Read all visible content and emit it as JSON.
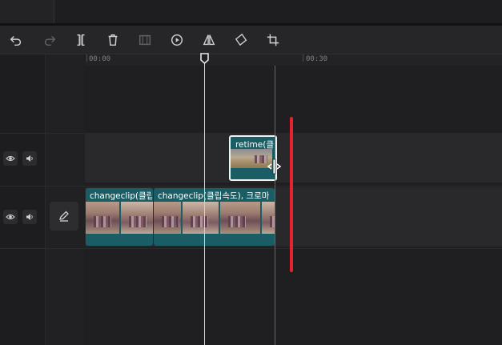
{
  "toolbar": {
    "undo_icon": "undo-icon",
    "redo_icon": "redo-icon",
    "split_icon": "split-icon",
    "delete_icon": "trash-icon",
    "freeze_icon": "freeze-frame-icon",
    "play_icon": "play-circle-icon",
    "mirror_icon": "mirror-icon",
    "rotate_icon": "rotate-icon",
    "crop_icon": "crop-icon"
  },
  "ruler": {
    "labels": [
      "00:00",
      "00:30"
    ]
  },
  "tracks": [
    {
      "eye_icon": "eye-icon",
      "volume_icon": "volume-icon",
      "clips": [
        {
          "name": "retime(클"
        }
      ]
    },
    {
      "eye_icon": "eye-icon",
      "volume_icon": "volume-icon",
      "edit_icon": "pencil-icon",
      "clips": [
        {
          "name": "changeclip(클립"
        },
        {
          "name": "changeclip(클립속도), 크로마"
        }
      ]
    }
  ],
  "colors": {
    "clip_fill": "#1b5d64",
    "drop_marker": "#e3242f",
    "snap_line": "#2a7f88",
    "playhead": "#cfd0d2"
  }
}
